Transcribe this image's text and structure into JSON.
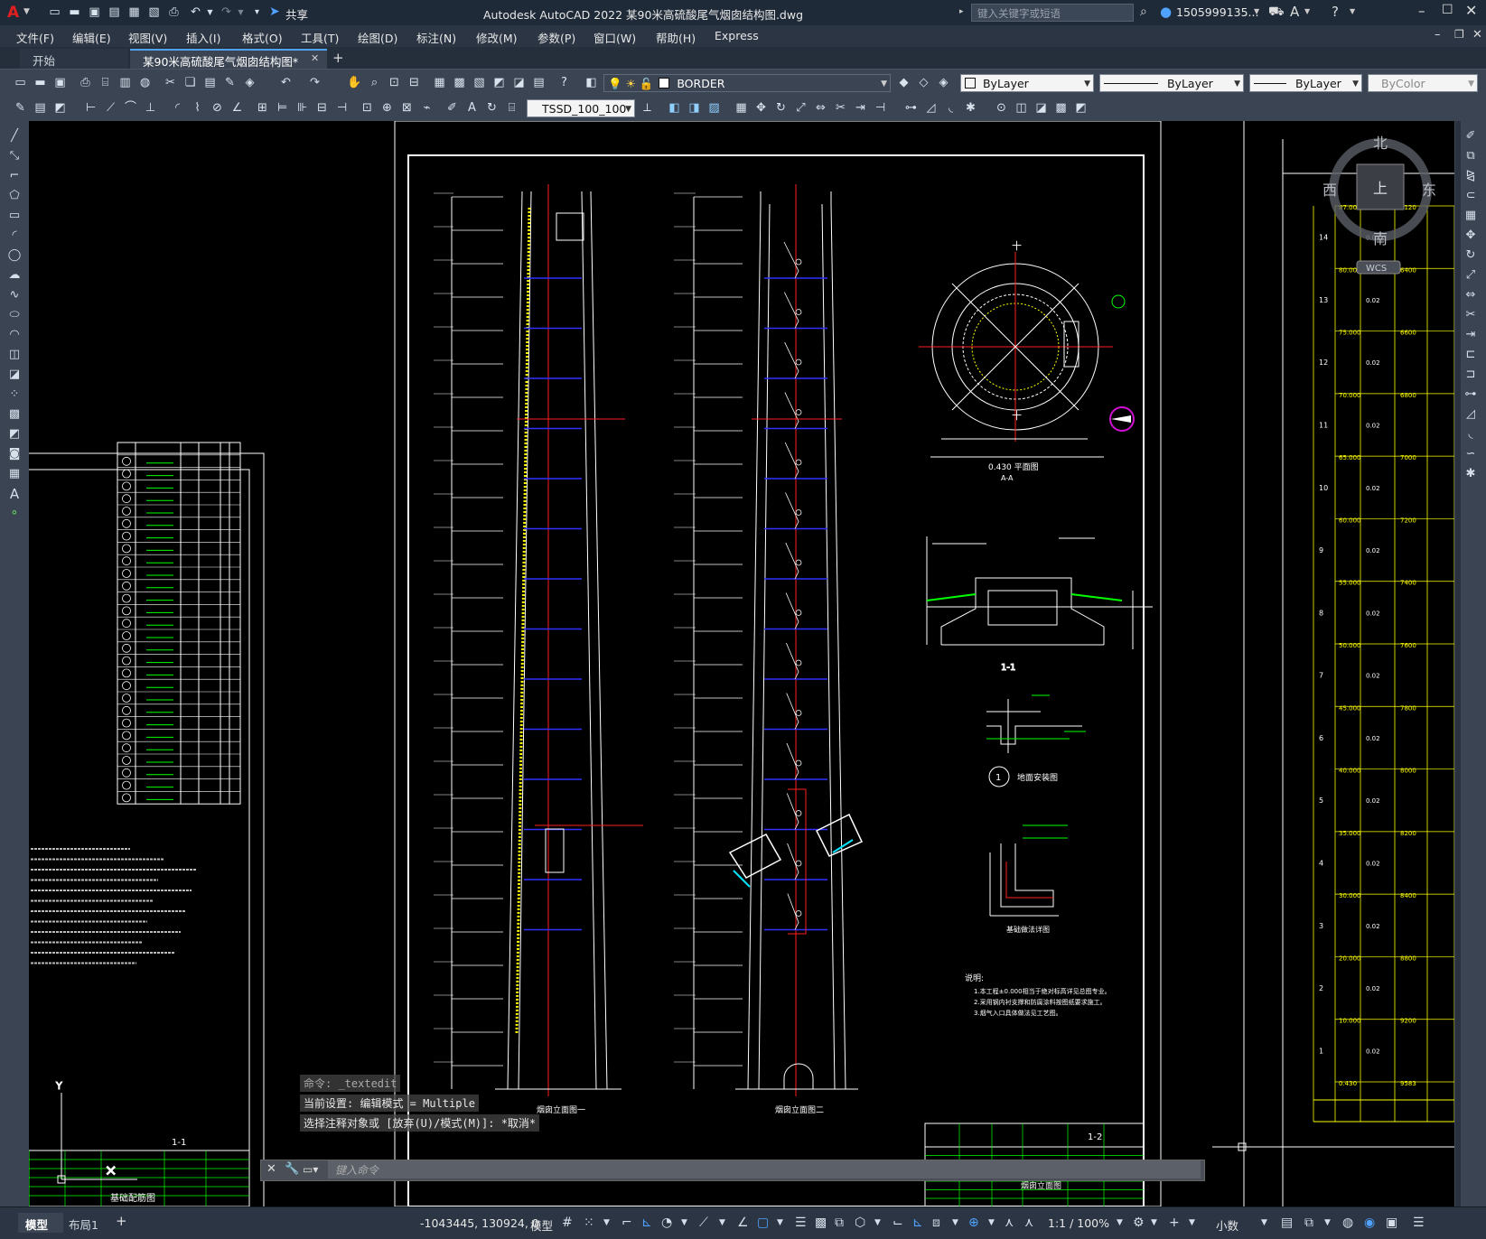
{
  "app": {
    "title": "Autodesk AutoCAD 2022    某90米高硫酸尾气烟囱结构图.dwg",
    "search_placeholder": "键入关键字或短语",
    "user": "1505999135...",
    "share_label": "共享"
  },
  "menu": [
    "文件(F)",
    "编辑(E)",
    "视图(V)",
    "插入(I)",
    "格式(O)",
    "工具(T)",
    "绘图(D)",
    "标注(N)",
    "修改(M)",
    "参数(P)",
    "窗口(W)",
    "帮助(H)",
    "Express"
  ],
  "doc_tabs": [
    "开始",
    "某90米高硫酸尾气烟囱结构图*"
  ],
  "toolbar": {
    "layer_name": "BORDER",
    "color": "ByLayer",
    "linetype": "ByLayer",
    "lineweight": "ByLayer",
    "plotstyle": "ByColor",
    "dimstyle": "TSSD_100_100"
  },
  "viewcube": {
    "north": "北",
    "south": "南",
    "east": "东",
    "west": "西",
    "top": "上",
    "wcs": "WCS"
  },
  "command": {
    "history1": "命令: _textedit",
    "history2": "当前设置: 编辑模式 = Multiple",
    "history3": "选择注释对象或 [放弃(U)/模式(M)]: *取消*",
    "placeholder": "键入命令"
  },
  "layout_tabs": [
    "模型",
    "布局1"
  ],
  "status": {
    "coords": "-1043445, 130924, 0",
    "mode": "模型",
    "scale": "1:1 / 100%",
    "units": "小数"
  },
  "drawing": {
    "title_elev1": "烟囱立面图一",
    "title_elev2": "烟囱立面图二",
    "plan_label": "0.430 平面图",
    "plan_sub": "A-A",
    "section_11": "1-1",
    "section_12": "1-2",
    "detail_label": "地面安装图",
    "detail_num": "1",
    "foundation_label": "基础配筋图",
    "notes_title": "说明:",
    "note1": "1.本工程±0.000相当于绝对标高详见总图专业。",
    "note2": "2.采用钢内衬支撑和防腐涂料按图纸要求施工。",
    "note3": "3.烟气入口具体做法见工艺图。",
    "detail_caption": "基础做法详图",
    "sheet_title": "烟囱立面图",
    "table_right": {
      "segments": [
        "14",
        "13",
        "12",
        "11",
        "10",
        "9",
        "8",
        "7",
        "6",
        "5",
        "4",
        "3",
        "2",
        "1"
      ],
      "elevations": [
        "87.000",
        "80.000",
        "75.000",
        "70.000",
        "65.000",
        "60.000",
        "55.000",
        "50.000",
        "45.000",
        "40.000",
        "35.000",
        "30.000",
        "20.000",
        "10.000",
        "0.430"
      ],
      "slope": "0.02",
      "diameters": [
        "6120",
        "6400",
        "6600",
        "6800",
        "7000",
        "7200",
        "7400",
        "7600",
        "7800",
        "8000",
        "8200",
        "8400",
        "8800",
        "9200",
        "9583"
      ]
    }
  },
  "colors": {
    "title_bg": "#1f2a38",
    "toolbar_bg": "#3b4453",
    "canvas_bg": "#000000",
    "line_white": "#ffffff",
    "line_red": "#ff2020",
    "line_blue": "#3030ff",
    "line_green": "#00ff40",
    "line_yellow": "#ffff40"
  }
}
